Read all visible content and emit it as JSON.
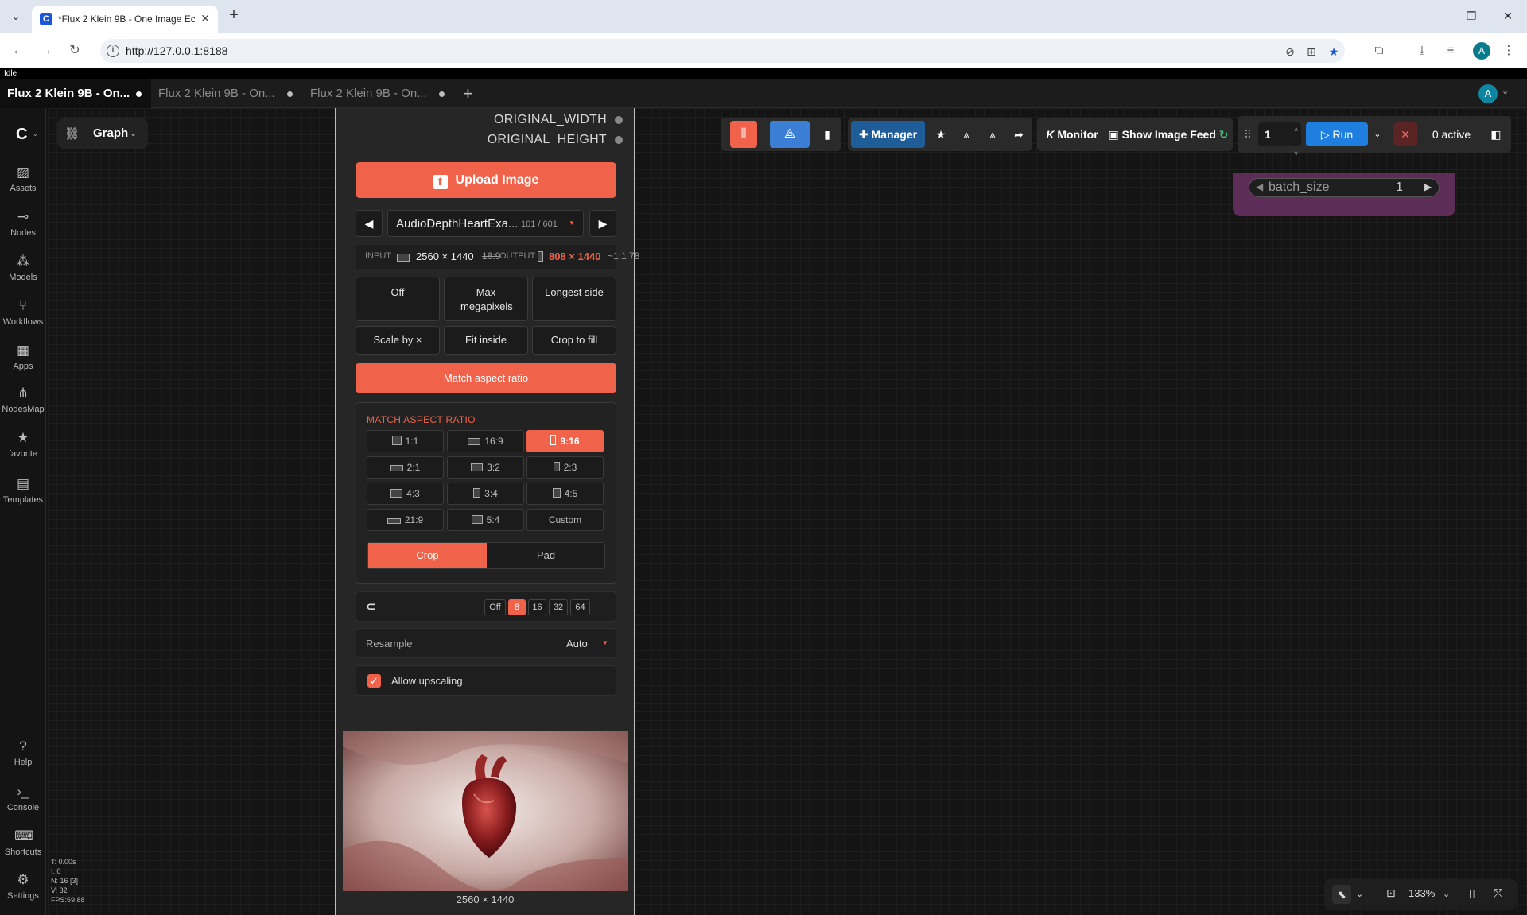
{
  "browser": {
    "tab_title": "*Flux 2 Klein 9B - One Image Ec",
    "favicon": "C",
    "url": "http://127.0.0.1:8188",
    "profile_initial": "A"
  },
  "app": {
    "status": "Idle",
    "workflow_tabs": [
      {
        "label": "Flux 2 Klein 9B - On..."
      },
      {
        "label": "Flux 2 Klein 9B - On..."
      },
      {
        "label": "Flux 2 Klein 9B - On..."
      }
    ],
    "user_initial": "A",
    "graph_label": "Graph"
  },
  "sidebar": {
    "items": [
      {
        "label": "Assets",
        "icon": "image-icon"
      },
      {
        "label": "Nodes",
        "icon": "nodes-icon"
      },
      {
        "label": "Models",
        "icon": "models-icon"
      },
      {
        "label": "Workflows",
        "icon": "workflows-icon"
      },
      {
        "label": "Apps",
        "icon": "apps-icon"
      },
      {
        "label": "NodesMap",
        "icon": "nodesmap-icon"
      },
      {
        "label": "favorite",
        "icon": "star-icon"
      },
      {
        "label": "Templates",
        "icon": "templates-icon"
      }
    ],
    "bottom_items": [
      {
        "label": "Help"
      },
      {
        "label": "Console"
      },
      {
        "label": "Shortcuts"
      },
      {
        "label": "Settings"
      }
    ],
    "perf": [
      "T: 0.00s",
      "I: 0",
      "N: 16 [3]",
      "V: 32",
      "FPS:59.88"
    ]
  },
  "node": {
    "outputs": [
      "ORIGINAL_WIDTH",
      "ORIGINAL_HEIGHT"
    ],
    "upload_label": "Upload Image",
    "file_name": "AudioDepthHeartExa...",
    "file_counter": "101 / 601",
    "input_label": "INPUT",
    "input_size": "2560 × 1440",
    "input_ratio": "16:9",
    "output_label": "OUTPUT",
    "output_size": "808 × 1440",
    "output_ratio": "~1:1.78",
    "modes_row1": [
      "Off",
      "Max megapixels",
      "Longest side"
    ],
    "modes_row2": [
      "Scale by ×",
      "Fit inside",
      "Crop to fill"
    ],
    "match_label": "Match aspect ratio",
    "ar_title": "MATCH ASPECT RATIO",
    "ratios": [
      "1:1",
      "16:9",
      "9:16",
      "2:1",
      "3:2",
      "2:3",
      "4:3",
      "3:4",
      "4:5",
      "21:9",
      "5:4",
      "Custom"
    ],
    "selected_ratio": "9:16",
    "crop_label": "Crop",
    "pad_label": "Pad",
    "snap_options": [
      "Off",
      "8",
      "16",
      "32",
      "64"
    ],
    "snap_selected": "8",
    "resample_label": "Resample",
    "resample_value": "Auto",
    "upscale_label": "Allow upscaling",
    "preview_caption": "2560 × 1440"
  },
  "toolbar": {
    "manager_label": "Manager",
    "monitor_label": "Monitor",
    "image_feed_label": "Show Image Feed",
    "queue_count": "1",
    "run_label": "Run",
    "active_label": "0 active"
  },
  "batch": {
    "label": "batch_size",
    "value": "1"
  },
  "canvas_controls": {
    "zoom": "133%"
  },
  "colors": {
    "accent": "#f0634a",
    "run_blue": "#1e7fe0",
    "manager_blue": "#1f5d99"
  }
}
